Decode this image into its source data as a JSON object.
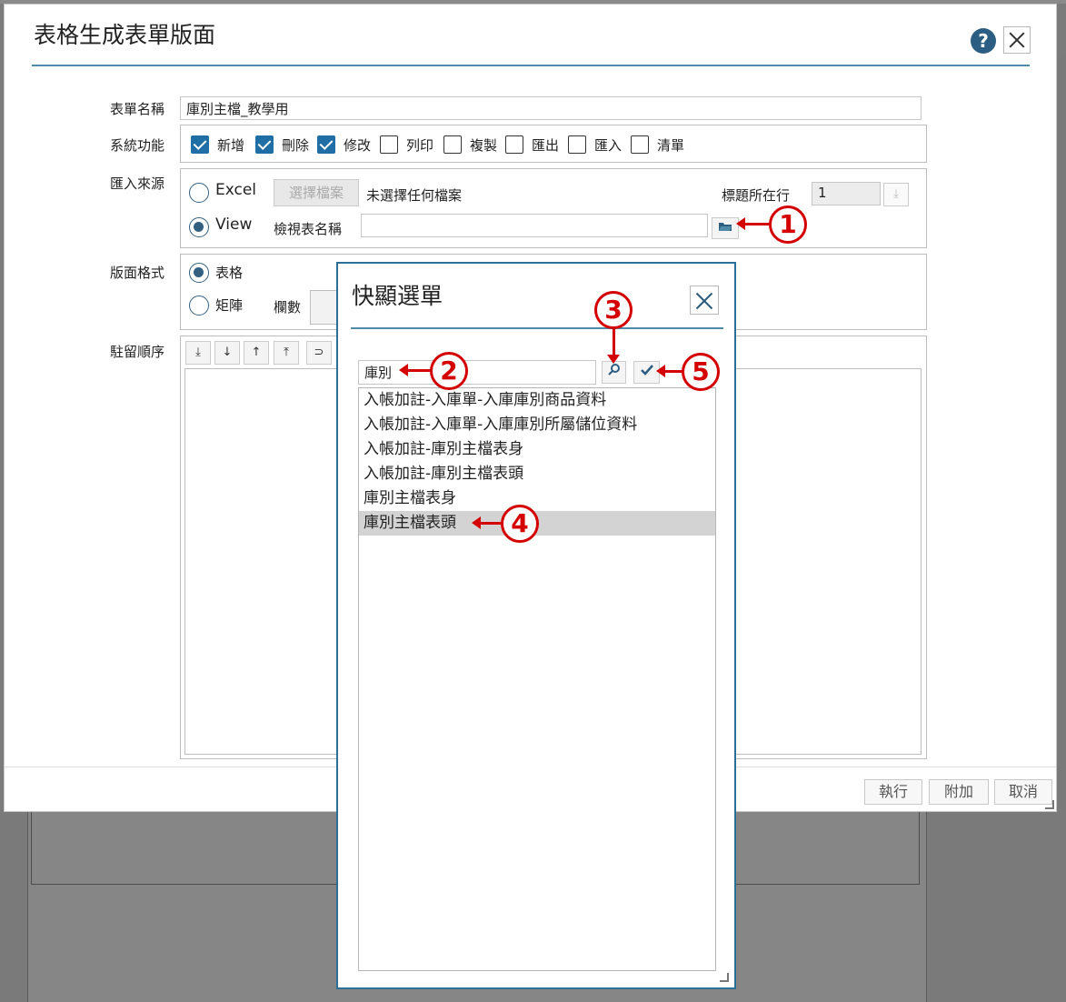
{
  "dialog": {
    "title": "表格生成表單版面",
    "form_name_label": "表單名稱",
    "form_name_value": "庫別主檔_教學用",
    "sys_func_label": "系統功能",
    "functions": [
      {
        "label": "新增",
        "checked": true
      },
      {
        "label": "刪除",
        "checked": true
      },
      {
        "label": "修改",
        "checked": true
      },
      {
        "label": "列印",
        "checked": false
      },
      {
        "label": "複製",
        "checked": false
      },
      {
        "label": "匯出",
        "checked": false
      },
      {
        "label": "匯入",
        "checked": false
      },
      {
        "label": "清單",
        "checked": false
      }
    ],
    "import_label": "匯入來源",
    "excel_label": "Excel",
    "select_file_label": "選擇檔案",
    "no_file_label": "未選擇任何檔案",
    "header_row_label": "標題所在行",
    "header_row_value": "1",
    "view_label": "View",
    "view_name_label": "檢視表名稱",
    "view_name_value": "",
    "layout_label": "版面格式",
    "layout_table": "表格",
    "layout_matrix": "矩陣",
    "columns_label": "欄數",
    "order_label": "駐留順序",
    "buttons": {
      "execute": "執行",
      "append": "附加",
      "cancel": "取消"
    }
  },
  "popup": {
    "title": "快顯選單",
    "search_value": "庫別",
    "items": [
      "入帳加註-入庫單-入庫庫別商品資料",
      "入帳加註-入庫單-入庫庫別所屬儲位資料",
      "入帳加註-庫別主檔表身",
      "入帳加註-庫別主檔表頭",
      "庫別主檔表身",
      "庫別主檔表頭"
    ],
    "selected_index": 5
  },
  "callouts": [
    "1",
    "2",
    "3",
    "4",
    "5"
  ],
  "colors": {
    "accent": "#1f6fa6",
    "callout": "#d40000",
    "rule": "#4f8aa6"
  }
}
